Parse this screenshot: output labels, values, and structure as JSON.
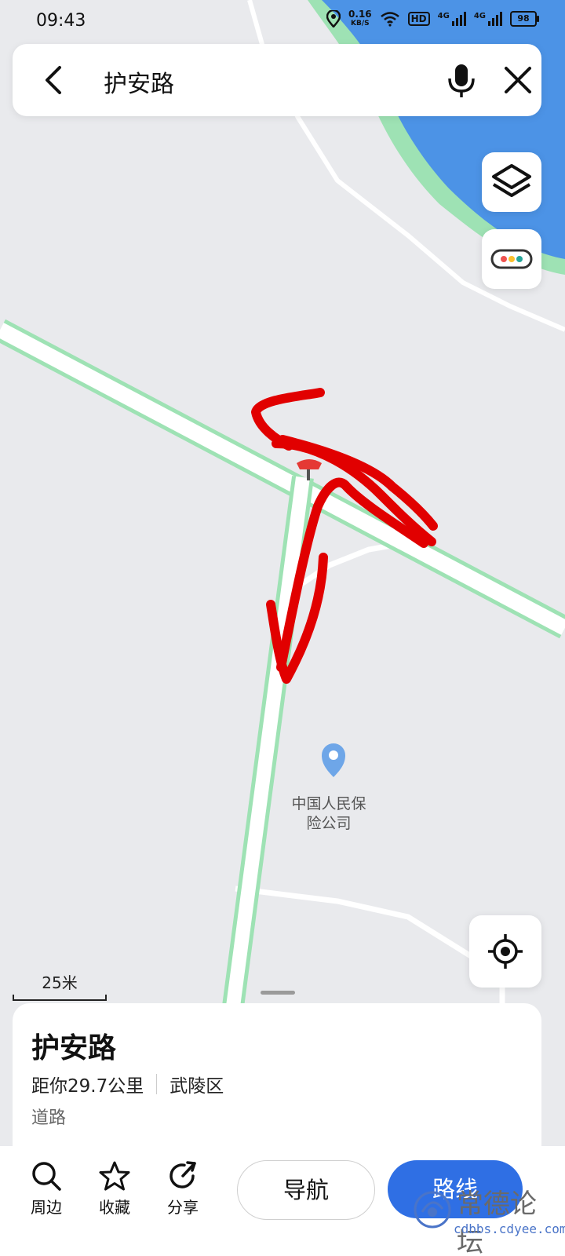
{
  "status_bar": {
    "time": "09:43",
    "net_speed_value": "0.16",
    "net_speed_unit": "KB/S",
    "hd_label": "HD",
    "network_type_1": "4G",
    "network_type_2": "4G",
    "battery_level": "98"
  },
  "search": {
    "query": "护安路",
    "back_icon": "chevron-left-icon",
    "mic_icon": "microphone-icon",
    "close_icon": "close-icon"
  },
  "map": {
    "poi_name": "中国人民保险公司",
    "scale_label": "25米",
    "water_color": "#4c93e6",
    "road_outline_color": "#9ee2b4",
    "annotation_color": "#e10000"
  },
  "side_buttons": {
    "layers_icon": "layers-icon",
    "more_icon": "dots-icon",
    "locate_icon": "locate-icon"
  },
  "place_card": {
    "title": "护安路",
    "distance": "距你29.7公里",
    "district": "武陵区",
    "type": "道路"
  },
  "bottom_bar": {
    "nearby": "周边",
    "favorite": "收藏",
    "share": "分享",
    "navigate": "导航",
    "route": "路线",
    "accent_color": "#2f6fe4"
  },
  "watermark": {
    "text": "常德论坛",
    "url": "cdbbs.cdyee.com"
  }
}
